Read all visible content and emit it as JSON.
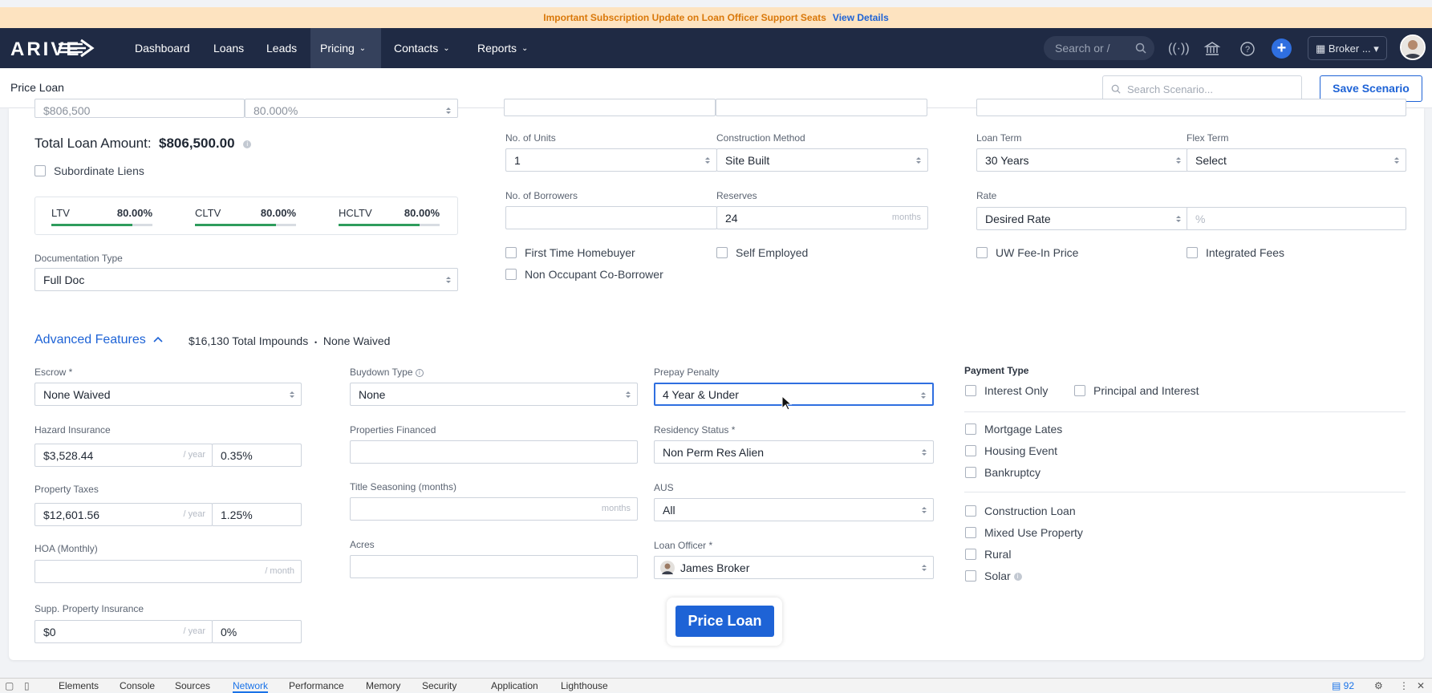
{
  "announcement": {
    "message": "Important Subscription Update on Loan Officer Support Seats",
    "link": "View Details"
  },
  "nav": {
    "items": [
      {
        "label": "Dashboard"
      },
      {
        "label": "Loans"
      },
      {
        "label": "Leads"
      },
      {
        "label": "Pricing",
        "active": true
      },
      {
        "label": "Contacts"
      },
      {
        "label": "Reports"
      }
    ],
    "search_placeholder": "Search or /",
    "broker_label": "Broker ...",
    "icons": [
      "search-icon",
      "broadcast-icon",
      "bank-icon",
      "help-icon",
      "plus-icon",
      "building-icon",
      "chevron-down-icon"
    ]
  },
  "subheader": {
    "title": "Price Loan",
    "search_placeholder": "Search Scenario...",
    "save_label": "Save Scenario"
  },
  "loan": {
    "top_left_partial": "$806,500",
    "top_left_partial2": "80.000%",
    "total_label": "Total Loan Amount:",
    "total_value": "$806,500.00",
    "subordinate_liens": "Subordinate Liens",
    "ltv": [
      {
        "label": "LTV",
        "value": "80.00%",
        "fill_pct": 80
      },
      {
        "label": "CLTV",
        "value": "80.00%",
        "fill_pct": 80
      },
      {
        "label": "HCLTV",
        "value": "80.00%",
        "fill_pct": 80
      }
    ],
    "doc_type_label": "Documentation Type",
    "doc_type_value": "Full Doc"
  },
  "property": {
    "units_label": "No. of Units",
    "units_value": "1",
    "construction_label": "Construction Method",
    "construction_value": "Site Built",
    "borrowers_label": "No. of Borrowers",
    "borrowers_value": "",
    "reserves_label": "Reserves",
    "reserves_value": "24",
    "reserves_suffix": "months",
    "first_time": "First Time Homebuyer",
    "self_employed": "Self Employed",
    "non_occupant": "Non Occupant Co-Borrower"
  },
  "terms": {
    "loan_term_label": "Loan Term",
    "loan_term_value": "30 Years",
    "flex_term_label": "Flex Term",
    "flex_term_value": "Select",
    "rate_label": "Rate",
    "rate_value": "Desired Rate",
    "rate_placeholder": "%",
    "uw_fee": "UW Fee-In Price",
    "integrated_fees": "Integrated Fees"
  },
  "advanced": {
    "title": "Advanced Features",
    "impounds": "$16,130 Total Impounds",
    "dot": "•",
    "waived": "None Waived",
    "escrow_label": "Escrow *",
    "escrow_value": "None Waived",
    "hazard_label": "Hazard Insurance",
    "hazard_value": "$3,528.44",
    "hazard_pct": "0.35%",
    "per_year": "/ year",
    "taxes_label": "Property Taxes",
    "taxes_value": "$12,601.56",
    "taxes_pct": "1.25%",
    "hoa_label": "HOA (Monthly)",
    "hoa_suffix": "/ month",
    "supp_label": "Supp. Property Insurance",
    "supp_value": "$0",
    "supp_pct": "0%",
    "buydown_label": "Buydown Type",
    "buydown_value": "None",
    "props_financed_label": "Properties Financed",
    "title_seasoning_label": "Title Seasoning (months)",
    "months_suffix": "months",
    "acres_label": "Acres",
    "prepay_label": "Prepay Penalty",
    "prepay_value": "4 Year & Under",
    "residency_label": "Residency Status *",
    "residency_value": "Non Perm Res Alien",
    "aus_label": "AUS",
    "aus_value": "All",
    "officer_label": "Loan Officer *",
    "officer_value": "James Broker",
    "payment_type_label": "Payment Type",
    "interest_only": "Interest Only",
    "principal_interest": "Principal and Interest",
    "mortgage_lates": "Mortgage Lates",
    "housing_event": "Housing Event",
    "bankruptcy": "Bankruptcy",
    "construction_loan": "Construction Loan",
    "mixed_use": "Mixed Use Property",
    "rural": "Rural",
    "solar": "Solar"
  },
  "price_button": "Price Loan",
  "devtools": {
    "tabs": [
      "Elements",
      "Console",
      "Sources",
      "Network",
      "Performance",
      "Memory",
      "Security",
      "Application",
      "Lighthouse"
    ],
    "active": "Network",
    "badge": "92"
  },
  "colors": {
    "nav_bg": "#1f2a44",
    "accent": "#1e63d6",
    "banner_bg": "#fde3c0",
    "banner_text": "#d9780a",
    "ltv_fill": "#2e9c5c"
  }
}
